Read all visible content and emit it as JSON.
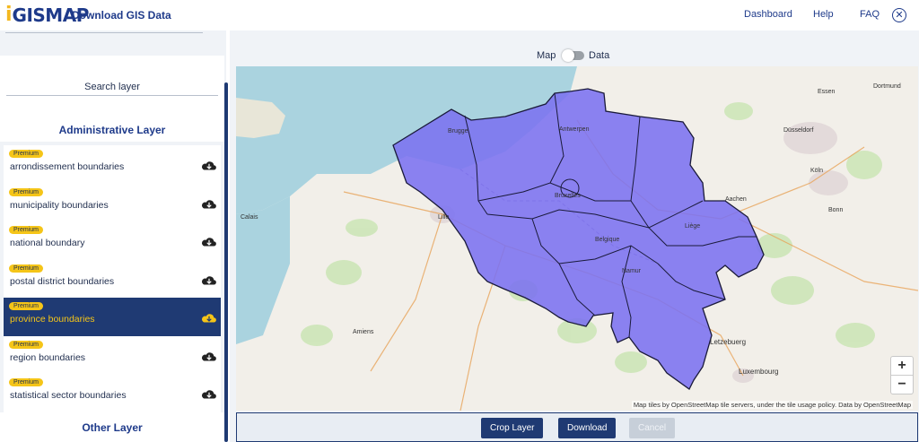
{
  "header": {
    "logo_i": "i",
    "logo_rest": "GISMAP",
    "title": "Download GIS Data",
    "nav": [
      "Dashboard",
      "Help",
      "FAQ"
    ]
  },
  "sidebar": {
    "search_placeholder": "Search layer",
    "admin_title": "Administrative Layer",
    "premium_label": "Premium",
    "layers": [
      {
        "label": "arrondissement boundaries",
        "active": false
      },
      {
        "label": "municipality boundaries",
        "active": false
      },
      {
        "label": "national boundary",
        "active": false
      },
      {
        "label": "postal district boundaries",
        "active": false
      },
      {
        "label": "province boundaries",
        "active": true
      },
      {
        "label": "region boundaries",
        "active": false
      },
      {
        "label": "statistical sector boundaries",
        "active": false
      }
    ],
    "other_title": "Other Layer"
  },
  "main": {
    "toggle_left": "Map",
    "toggle_right": "Data",
    "zoom_in": "+",
    "zoom_out": "−",
    "attribution": "Map tiles by OpenStreetMap tile servers, under the tile usage policy. Data by OpenStreetMap",
    "buttons": {
      "crop": "Crop Layer",
      "download": "Download",
      "cancel": "Cancel"
    }
  },
  "map_labels": [
    "Brugge",
    "Antwerpen",
    "Bruxelles",
    "Belgique",
    "Liège",
    "Luxembourg",
    "Letzebuerg",
    "Düsseldorf",
    "Köln",
    "Essen",
    "Dortmund",
    "Bonn",
    "Lille",
    "Amiens",
    "Calais",
    "Aachen",
    "Namur"
  ],
  "colors": {
    "accent": "#1f3a73",
    "premium": "#f5c518",
    "polygon": "#7b72f0"
  }
}
